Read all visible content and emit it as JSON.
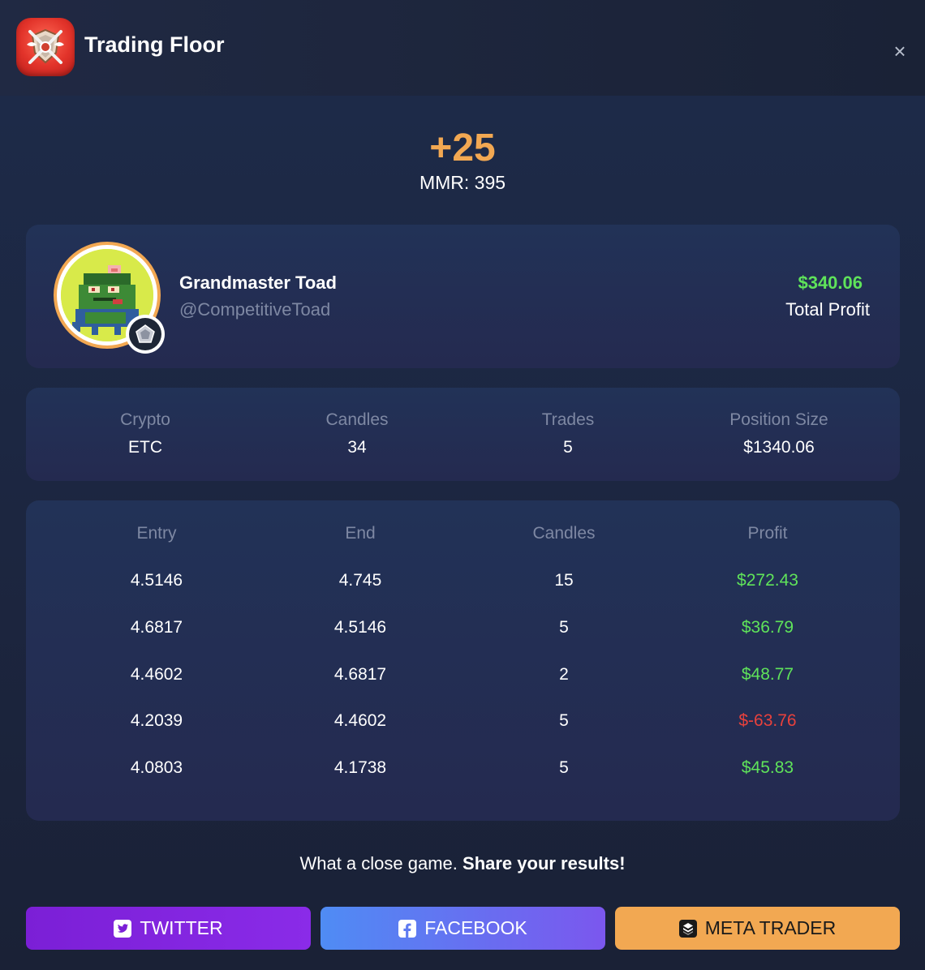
{
  "app": {
    "title": "Trading Floor",
    "close_symbol": "×"
  },
  "result": {
    "mmr_delta": "+25",
    "mmr_text": "MMR: 395"
  },
  "player": {
    "name": "Grandmaster Toad",
    "handle": "@CompetitiveToad",
    "total_profit": "$340.06",
    "total_profit_label": "Total Profit"
  },
  "stats": [
    {
      "label": "Crypto",
      "value": "ETC"
    },
    {
      "label": "Candles",
      "value": "34"
    },
    {
      "label": "Trades",
      "value": "5"
    },
    {
      "label": "Position Size",
      "value": "$1340.06"
    }
  ],
  "trades": {
    "headers": [
      "Entry",
      "End",
      "Candles",
      "Profit"
    ],
    "rows": [
      {
        "entry": "4.5146",
        "end": "4.745",
        "candles": "15",
        "profit": "$272.43"
      },
      {
        "entry": "4.6817",
        "end": "4.5146",
        "candles": "5",
        "profit": "$36.79"
      },
      {
        "entry": "4.4602",
        "end": "4.6817",
        "candles": "2",
        "profit": "$48.77"
      },
      {
        "entry": "4.2039",
        "end": "4.4602",
        "candles": "5",
        "profit": "$-63.76"
      },
      {
        "entry": "4.0803",
        "end": "4.1738",
        "candles": "5",
        "profit": "$45.83"
      }
    ]
  },
  "share": {
    "lead": "What a close game. ",
    "cta": "Share your results!"
  },
  "buttons": {
    "twitter": "TWITTER",
    "facebook": "FACEBOOK",
    "meta_trader": "META TRADER"
  },
  "colors": {
    "accent_orange": "#f2a852",
    "profit_positive": "#5fe35a",
    "profit_negative": "#e8413c",
    "muted_text": "#7e88a3"
  },
  "icons": {
    "app_logo": "crossed-swords-shield-icon",
    "close": "close-icon",
    "rank": "pentagon-rank-icon",
    "twitter": "twitter-icon",
    "facebook": "facebook-icon",
    "meta_trader": "meta-trader-icon"
  }
}
